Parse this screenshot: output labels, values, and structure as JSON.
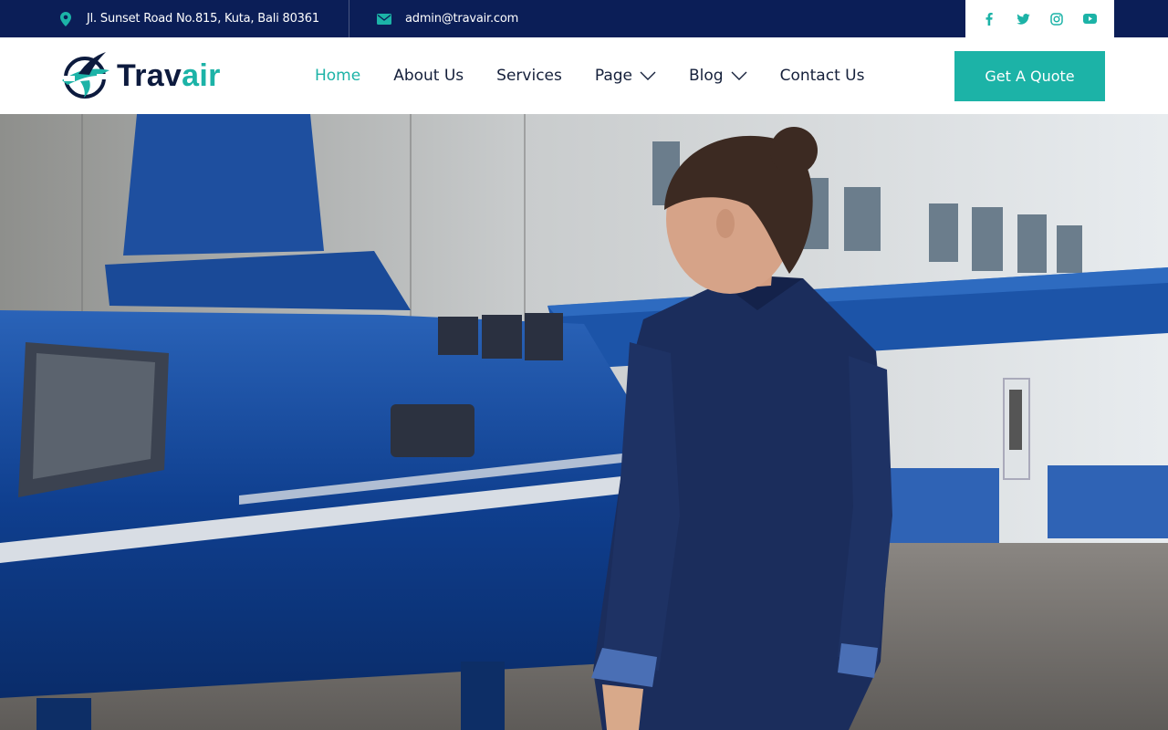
{
  "topbar": {
    "address": "Jl. Sunset Road No.815, Kuta, Bali 80361",
    "email": "admin@travair.com",
    "social": [
      {
        "icon": "facebook-icon"
      },
      {
        "icon": "twitter-icon"
      },
      {
        "icon": "instagram-icon"
      },
      {
        "icon": "youtube-icon"
      }
    ]
  },
  "brand": {
    "name_main": "Trav",
    "name_accent": "air"
  },
  "nav": {
    "items": [
      {
        "label": "Home",
        "active": true
      },
      {
        "label": "About Us"
      },
      {
        "label": "Services"
      },
      {
        "label": "Page",
        "dropdown": true
      },
      {
        "label": "Blog",
        "dropdown": true
      },
      {
        "label": "Contact Us"
      }
    ]
  },
  "cta": {
    "label": "Get A Quote"
  },
  "colors": {
    "topbar_bg": "#0b1e57",
    "accent": "#1cb3a7",
    "brand_dark": "#0d1b3e",
    "nav_text": "#15203b"
  },
  "hero": {
    "image": "woman walking beside blue helicopter at hangar"
  }
}
